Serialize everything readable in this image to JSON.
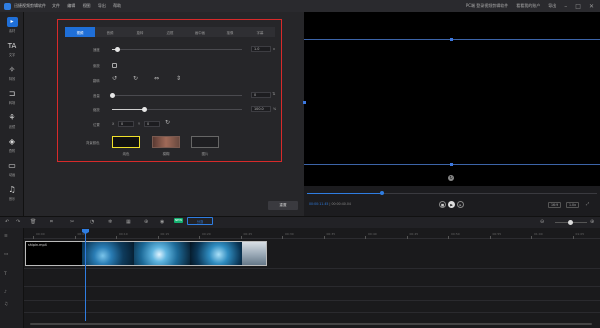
{
  "titlebar": {
    "title": "迅捷视频剪辑软件",
    "menu": [
      "文件",
      "编辑",
      "视图",
      "导出",
      "帮助"
    ],
    "notice": "PC端 登录视频剪辑软件",
    "user": "看看我的账户",
    "export_label": "导出"
  },
  "sidebar": {
    "items": [
      {
        "label": "素材",
        "icon": "import-icon"
      },
      {
        "label": "文字",
        "icon": "text-icon"
      },
      {
        "label": "特效",
        "icon": "effect-icon"
      },
      {
        "label": "转场",
        "icon": "transition-icon"
      },
      {
        "label": "滤镜",
        "icon": "filter-icon"
      },
      {
        "label": "叠附",
        "icon": "overlay-icon"
      },
      {
        "label": "动画",
        "icon": "animation-icon"
      },
      {
        "label": "音乐",
        "icon": "music-icon"
      }
    ]
  },
  "props": {
    "tabs": [
      "视频",
      "音频",
      "旋转",
      "边框",
      "画中画",
      "抠像",
      "字幕"
    ],
    "active_tab": 0,
    "speed_label": "速度",
    "speed_value": "1.0",
    "speed_unit": "x",
    "speed_fraction": 0.04,
    "reverse_label": "倒放",
    "rotate_label": "翻转",
    "volume_label": "音量",
    "volume_value": "0",
    "volume_fraction": 0.0,
    "scale_label": "缩放",
    "scale_value": "100.0",
    "scale_unit": "%",
    "scale_fraction": 0.25,
    "position_label": "位置",
    "pos_x_label": "X",
    "pos_x": "0",
    "pos_y_label": "Y",
    "pos_y": "0",
    "bg_label": "背景颜色",
    "bg_options": [
      "纯色",
      "模糊",
      "图片"
    ],
    "reset_label": "重置"
  },
  "preview": {
    "current_time": "00:00:11.45",
    "total_time": "00:00:40.04",
    "progress_fraction": 0.26,
    "ratio": "16:9",
    "zoom": "1.0x"
  },
  "timeline": {
    "split_label": "分割",
    "badge": "NEW",
    "clip_name": "shipin.mp4",
    "ticks": [
      "00:00",
      "00:05",
      "00:10",
      "00:15",
      "00:20",
      "00:25",
      "00:30",
      "00:35",
      "00:40",
      "00:45",
      "00:50",
      "00:55",
      "01:00",
      "01:05"
    ]
  }
}
